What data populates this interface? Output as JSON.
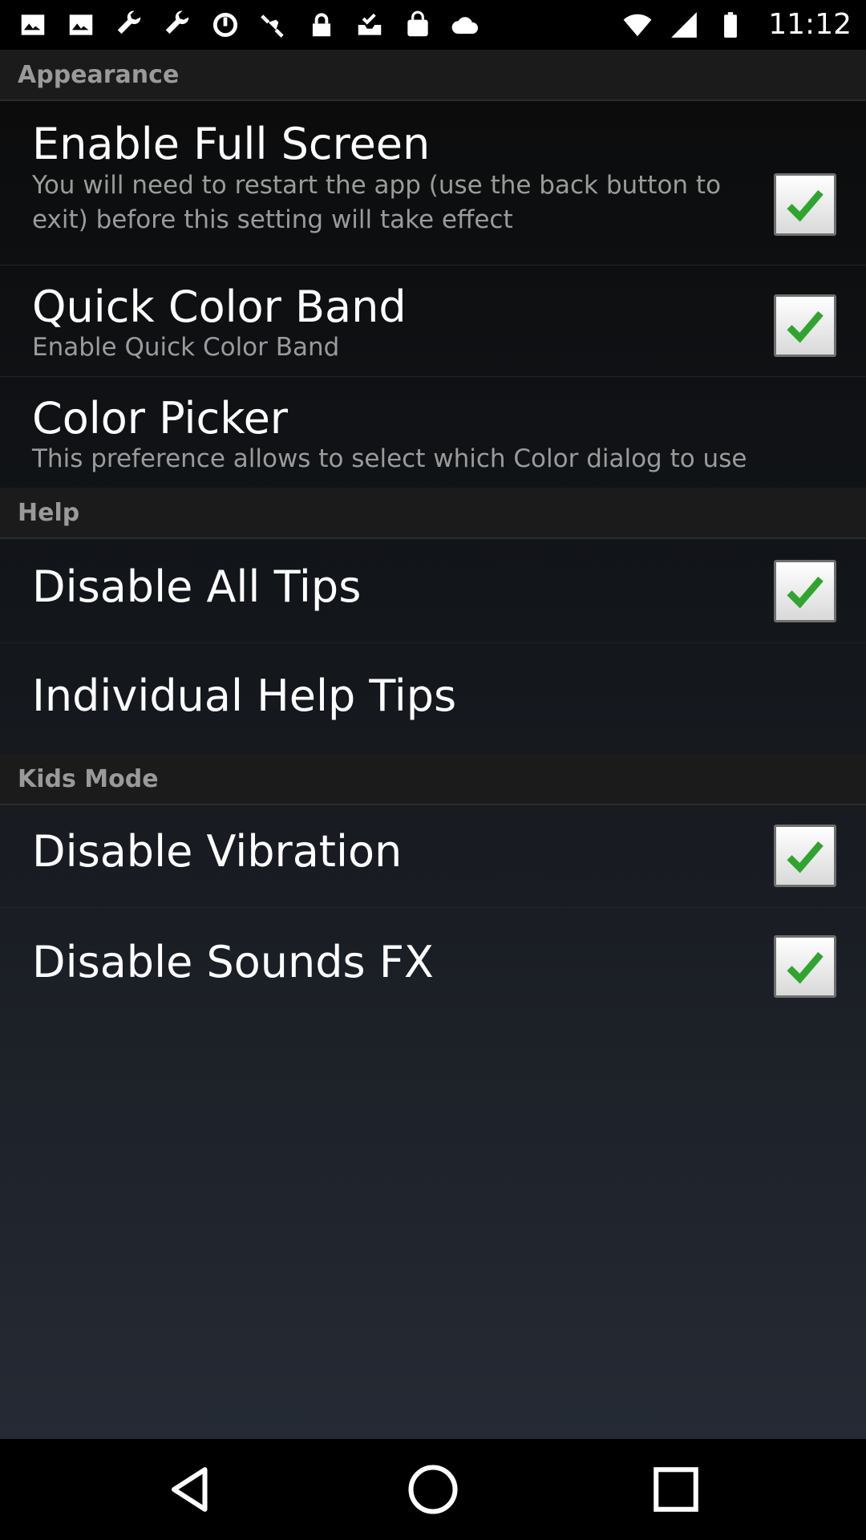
{
  "status_bar": {
    "time": "11:12",
    "left_icons": [
      "image-icon",
      "image-icon",
      "wrench-icon",
      "wrench-icon",
      "sync-icon",
      "satellite-icon",
      "lock-icon",
      "inbox-check-icon",
      "bag-icon",
      "cloud-icon"
    ],
    "right_icons": [
      "wifi-icon",
      "signal-icon",
      "battery-icon"
    ]
  },
  "sections": {
    "appearance": {
      "header": "Appearance"
    },
    "help": {
      "header": "Help"
    },
    "kids_mode": {
      "header": "Kids Mode"
    }
  },
  "prefs": {
    "full_screen": {
      "title": "Enable Full Screen",
      "summary": "You will need to restart the app (use the back button to exit) before this setting will take effect",
      "checked": true
    },
    "quick_color_band": {
      "title": "Quick Color Band",
      "summary": "Enable Quick Color Band",
      "checked": true
    },
    "color_picker": {
      "title": "Color Picker",
      "summary": "This preference allows to select which Color dialog to use"
    },
    "disable_all_tips": {
      "title": "Disable All Tips",
      "checked": true
    },
    "individual_help_tips": {
      "title": "Individual Help Tips"
    },
    "disable_vibration": {
      "title": "Disable Vibration",
      "checked": true
    },
    "disable_sounds_fx": {
      "title": "Disable Sounds FX",
      "checked": true
    }
  },
  "nav_bar": {
    "icons": [
      "back-icon",
      "home-icon",
      "recents-icon"
    ]
  },
  "colors": {
    "checkmark": "#2fa52f",
    "section_header_bg": "#1b1b1b",
    "section_header_text": "#9a9a9a"
  }
}
